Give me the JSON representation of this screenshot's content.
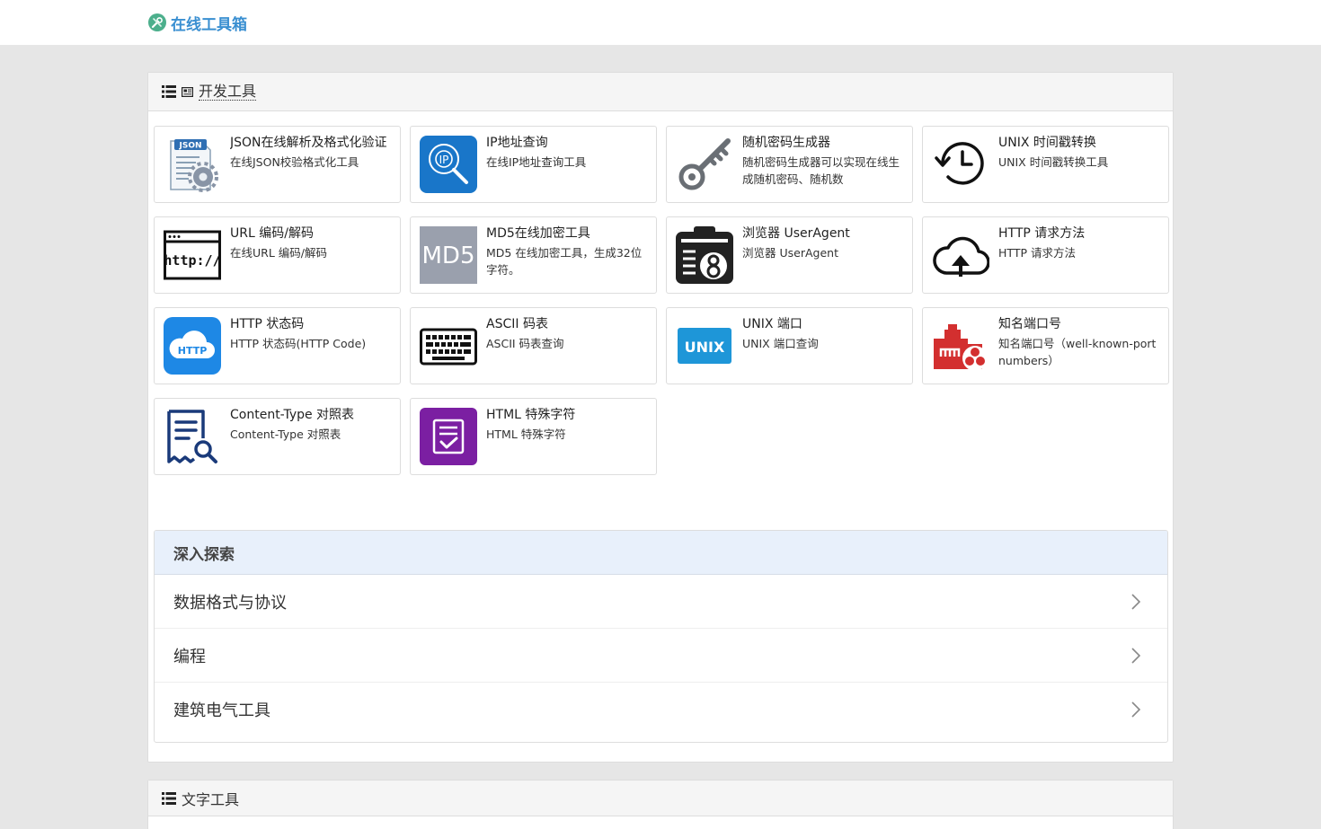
{
  "brand": {
    "name": "在线工具箱",
    "color": "#3a8fd1"
  },
  "sections": {
    "dev": {
      "title": "开发工具"
    },
    "text": {
      "title": "文字工具"
    }
  },
  "tools": [
    {
      "title": "JSON在线解析及格式化验证",
      "desc": "在线JSON校验格式化工具",
      "icon": "json-icon"
    },
    {
      "title": "IP地址查询",
      "desc": "在线IP地址查询工具",
      "icon": "ip-search-icon"
    },
    {
      "title": "随机密码生成器",
      "desc": "随机密码生成器可以实现在线生成随机密码、随机数",
      "icon": "key-icon"
    },
    {
      "title": "UNIX 时间戳转换",
      "desc": "UNIX 时间戳转换工具",
      "icon": "clock-history-icon"
    },
    {
      "title": "URL 编码/解码",
      "desc": "在线URL 编码/解码",
      "icon": "http-window-icon",
      "icon_text": "http://"
    },
    {
      "title": "MD5在线加密工具",
      "desc": "MD5 在线加密工具，生成32位字符。",
      "icon": "md5-icon",
      "icon_text": "MD5"
    },
    {
      "title": "浏览器 UserAgent",
      "desc": "浏览器 UserAgent",
      "icon": "user-agent-icon"
    },
    {
      "title": "HTTP 请求方法",
      "desc": "HTTP 请求方法",
      "icon": "cloud-upload-icon"
    },
    {
      "title": "HTTP 状态码",
      "desc": "HTTP 状态码(HTTP Code)",
      "icon": "http-cloud-icon",
      "icon_text": "HTTP"
    },
    {
      "title": "ASCII 码表",
      "desc": "ASCII 码表查询",
      "icon": "keyboard-icon"
    },
    {
      "title": "UNIX 端口",
      "desc": "UNIX 端口查询",
      "icon": "unix-icon",
      "icon_text": "UNIX"
    },
    {
      "title": "知名端口号",
      "desc": "知名端口号（well-known-port numbers）",
      "icon": "port-network-icon"
    },
    {
      "title": "Content-Type 对照表",
      "desc": "Content-Type 对照表",
      "icon": "document-search-icon"
    },
    {
      "title": "HTML 特殊字符",
      "desc": "HTML 特殊字符",
      "icon": "html-checklist-icon"
    }
  ],
  "explore": {
    "title": "深入探索",
    "items": [
      "数据格式与协议",
      "编程",
      "建筑电气工具"
    ]
  }
}
